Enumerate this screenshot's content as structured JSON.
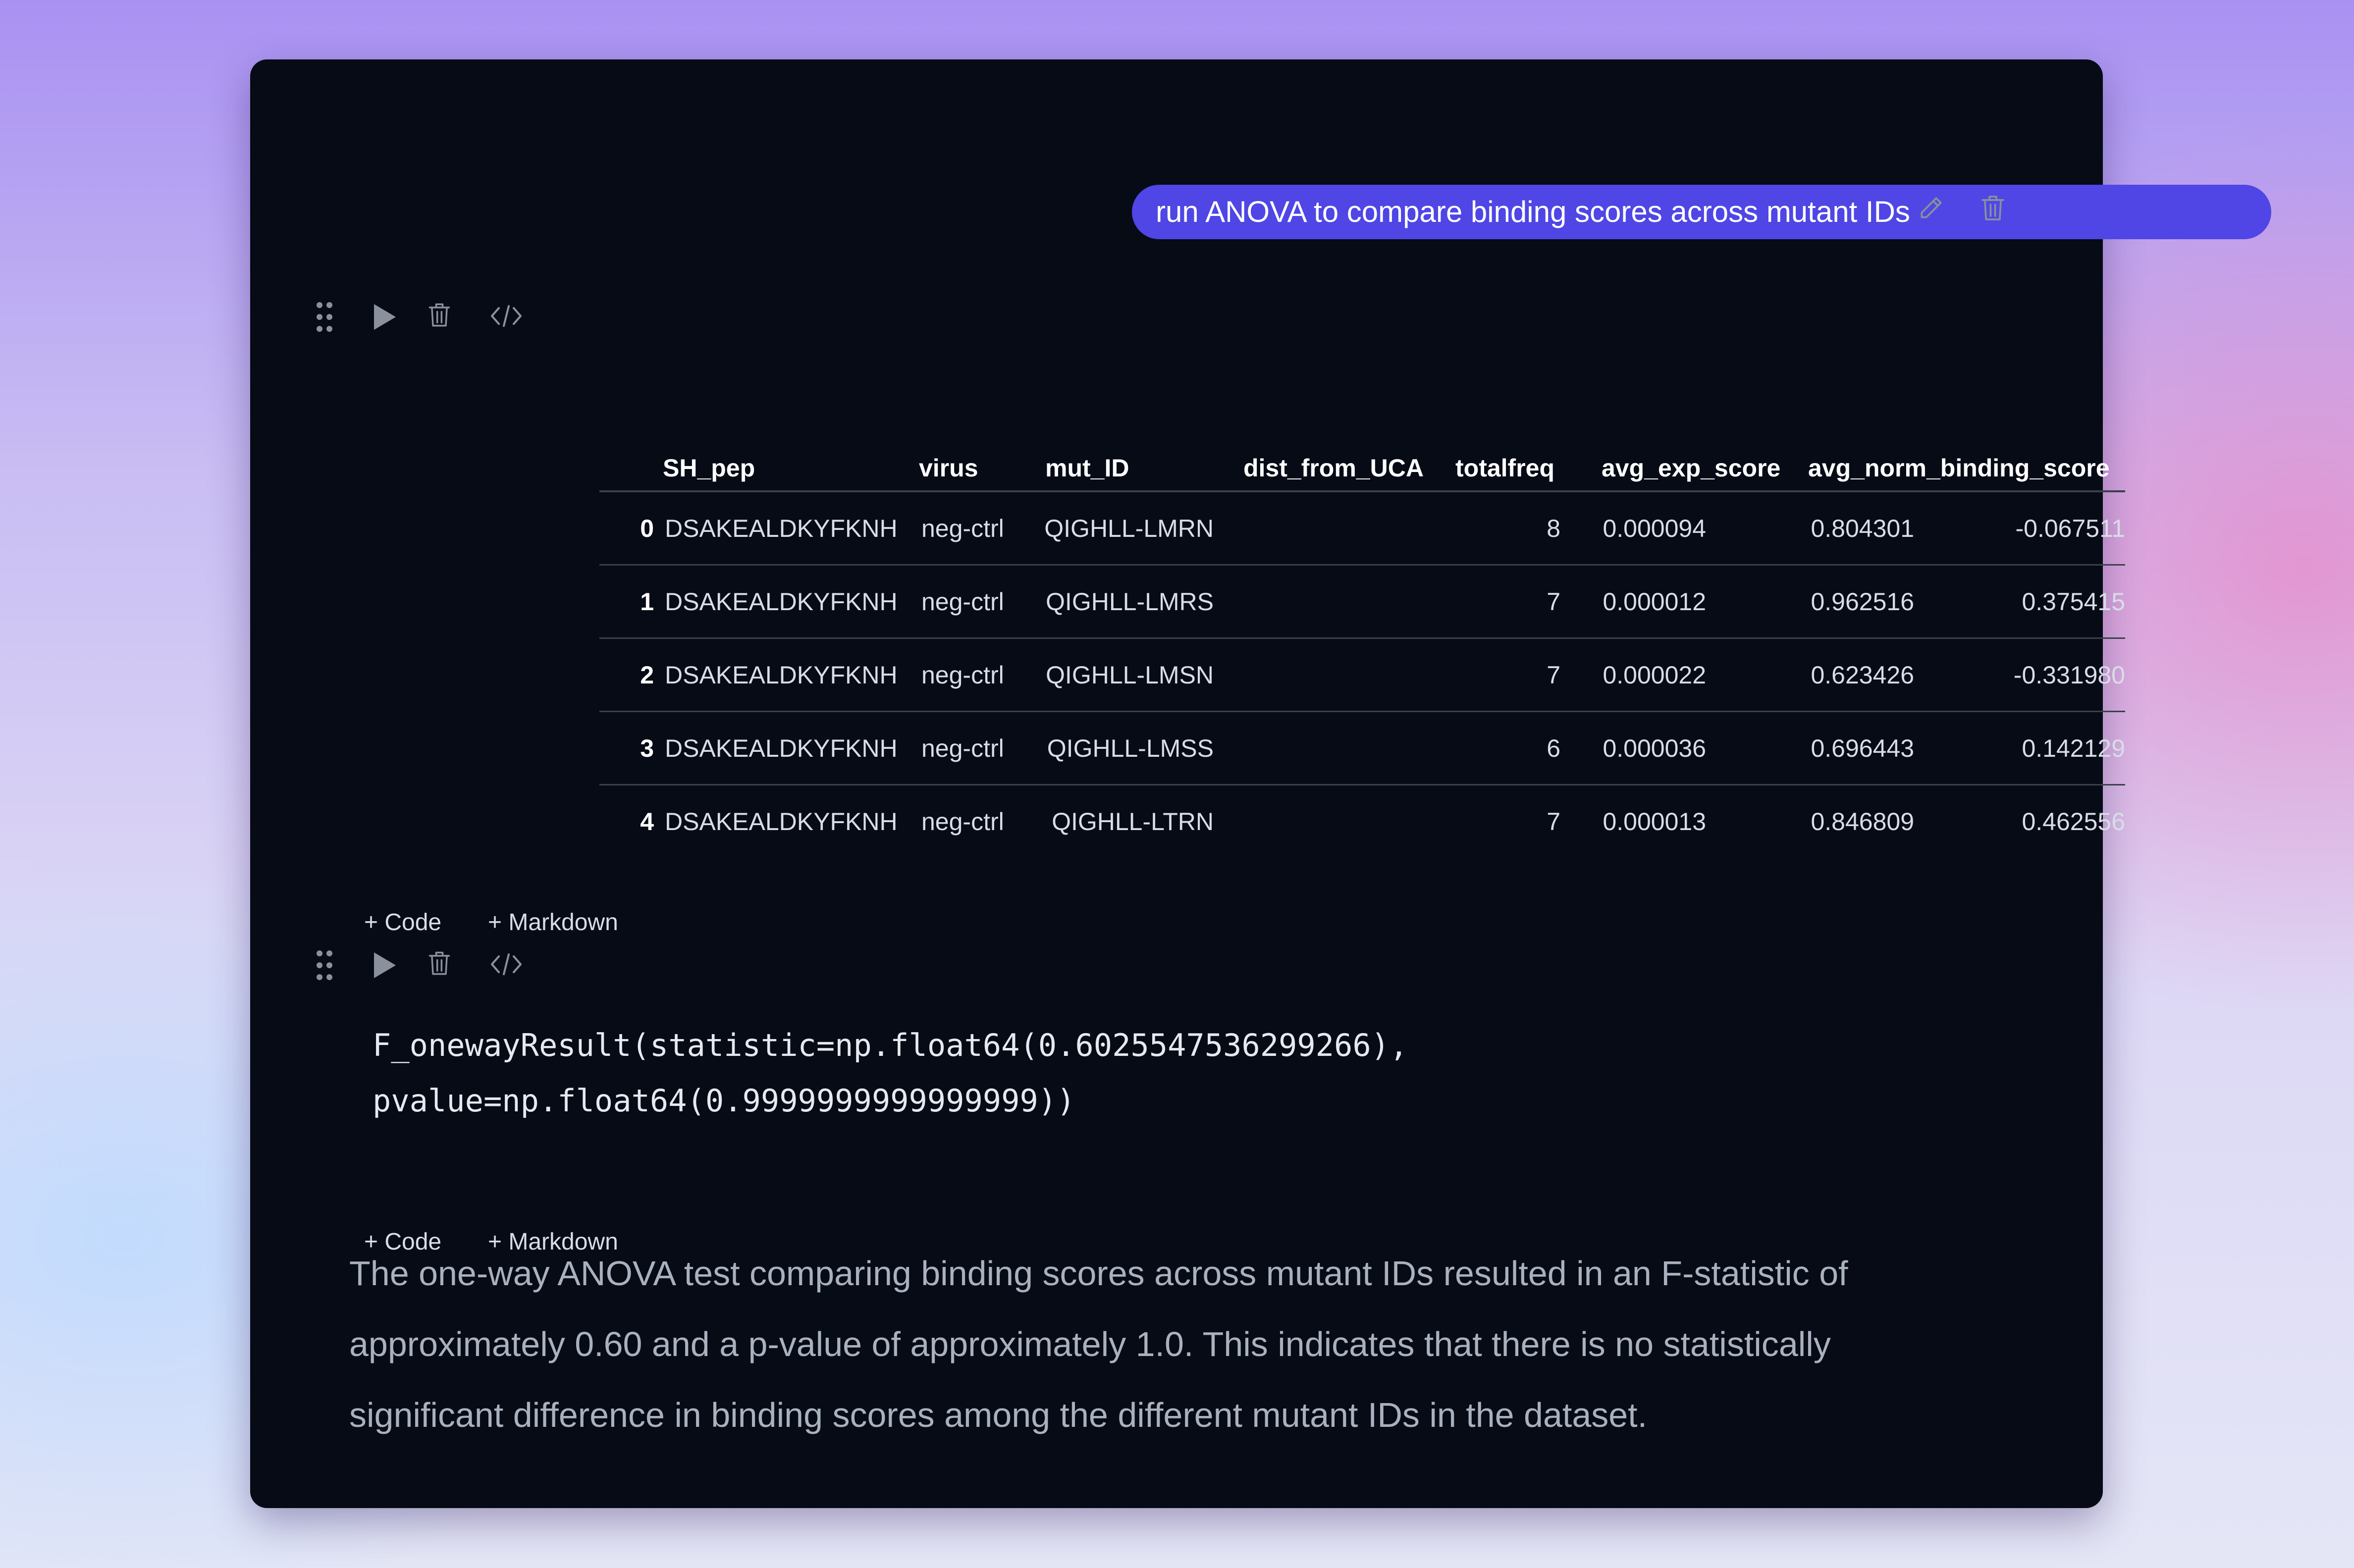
{
  "prompt": {
    "text": "run ANOVA to compare binding scores across mutant IDs"
  },
  "cells": {
    "table_cell": {
      "columns": [
        "",
        "SH_pep",
        "virus",
        "mut_ID",
        "dist_from_UCA",
        "totalfreq",
        "avg_exp_score",
        "avg_norm_binding_score"
      ],
      "rows": [
        [
          "0",
          "DSAKEALDKYFKNH",
          "neg-ctrl",
          "QIGHLL-LMRN",
          "8",
          "0.000094",
          "0.804301",
          "-0.067511"
        ],
        [
          "1",
          "DSAKEALDKYFKNH",
          "neg-ctrl",
          "QIGHLL-LMRS",
          "7",
          "0.000012",
          "0.962516",
          "0.375415"
        ],
        [
          "2",
          "DSAKEALDKYFKNH",
          "neg-ctrl",
          "QIGHLL-LMSN",
          "7",
          "0.000022",
          "0.623426",
          "-0.331980"
        ],
        [
          "3",
          "DSAKEALDKYFKNH",
          "neg-ctrl",
          "QIGHLL-LMSS",
          "6",
          "0.000036",
          "0.696443",
          "0.142129"
        ],
        [
          "4",
          "DSAKEALDKYFKNH",
          "neg-ctrl",
          "QIGHLL-LTRN",
          "7",
          "0.000013",
          "0.846809",
          "0.462556"
        ]
      ]
    },
    "output_cell": {
      "lines": [
        "F_onewayResult(statistic=np.float64(0.6025547536299266),",
        "pvalue=np.float64(0.9999999999999999))"
      ]
    }
  },
  "add_bar": {
    "code": "+ Code",
    "markdown": "+ Markdown"
  },
  "summary": {
    "lines": [
      "The one-way ANOVA test comparing binding scores across mutant IDs resulted in an F-statistic of",
      "approximately 0.60 and a p-value of approximately 1.0. This indicates that there is no statistically",
      "significant difference in binding scores among the different mutant IDs in the dataset."
    ]
  },
  "icons": {
    "prompt_actions": [
      "pencil-icon",
      "trash-icon"
    ],
    "cell_toolbar": [
      "drag-handle-icon",
      "play-icon",
      "trash-icon",
      "code-icon"
    ]
  },
  "colors": {
    "accent": "#4f46e5",
    "card_background": "#060b16",
    "text_muted": "#aab1be",
    "icon": "#8a909c"
  }
}
